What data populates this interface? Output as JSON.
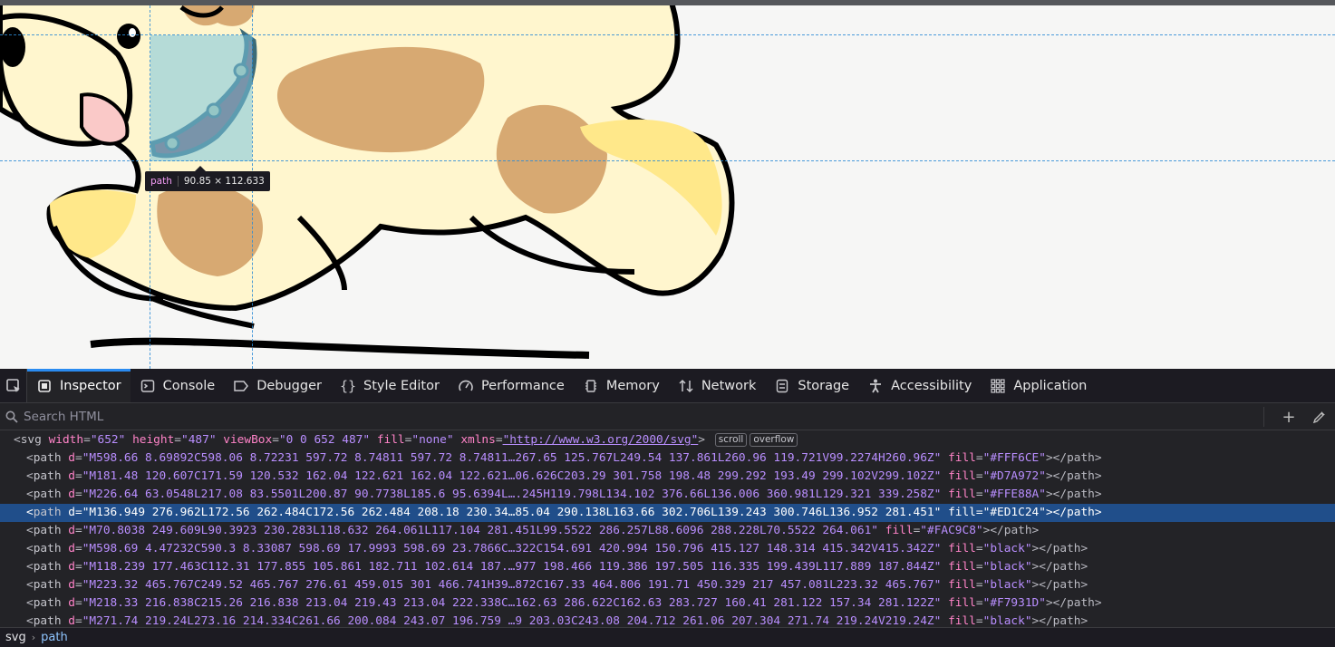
{
  "highlighter": {
    "tooltip_tag": "path",
    "tooltip_dims": "90.85 × 112.633"
  },
  "tabs": [
    {
      "label": "Inspector",
      "icon": "inspector-icon"
    },
    {
      "label": "Console",
      "icon": "console-icon"
    },
    {
      "label": "Debugger",
      "icon": "debugger-icon"
    },
    {
      "label": "Style Editor",
      "icon": "braces-icon"
    },
    {
      "label": "Performance",
      "icon": "gauge-icon"
    },
    {
      "label": "Memory",
      "icon": "memory-icon"
    },
    {
      "label": "Network",
      "icon": "arrows-icon"
    },
    {
      "label": "Storage",
      "icon": "storage-icon"
    },
    {
      "label": "Accessibility",
      "icon": "accessibility-icon"
    },
    {
      "label": "Application",
      "icon": "grid-icon"
    }
  ],
  "search": {
    "placeholder": "Search HTML"
  },
  "tree": {
    "root": {
      "tag": "svg",
      "attrs": [
        {
          "name": "width",
          "value": "\"652\""
        },
        {
          "name": "height",
          "value": "\"487\""
        },
        {
          "name": "viewBox",
          "value": "\"0 0 652 487\""
        },
        {
          "name": "fill",
          "value": "\"none\""
        },
        {
          "name": "xmlns",
          "value": "\"http://www.w3.org/2000/svg\""
        }
      ],
      "badges": [
        "scroll",
        "overflow"
      ]
    },
    "rows": [
      {
        "d": "\"M598.66 8.69892C598.06 8.72231 597.72 8.74811 597.72 8.74811…267.65 125.767L249.54 137.861L260.96 119.721V99.2274H260.96Z\"",
        "fill": "\"#FFF6CE\""
      },
      {
        "d": "\"M181.48 120.607C171.59 120.532 162.04 122.621 162.04 122.621…06.626C203.29 301.758 198.48 299.292 193.49 299.102V299.102Z\"",
        "fill": "\"#D7A972\""
      },
      {
        "d": "\"M226.64 63.0548L217.08 83.5501L200.87 90.7738L185.6 95.6394L….245H119.798L134.102 376.66L136.006 360.981L129.321 339.258Z\"",
        "fill": "\"#FFE88A\""
      },
      {
        "d": "\"M136.949 276.962L172.56 262.484C172.56 262.484 208.18 230.34…85.04 290.138L163.66 302.706L139.243 300.746L136.952 281.451\"",
        "fill": "\"#ED1C24\""
      },
      {
        "d": "\"M70.8038 249.609L90.3923 230.283L118.632 264.061L117.104 281.451L99.5522 286.257L88.6096 288.228L70.5522 264.061\"",
        "fill": "\"#FAC9C8\""
      },
      {
        "d": "\"M598.69 4.47232C590.3 8.33087 598.69 17.9993 598.69 23.7866C…322C154.691 420.994 150.796 415.127 148.314 415.342V415.342Z\"",
        "fill": "\"black\""
      },
      {
        "d": "\"M118.239 177.463C112.31 177.855 105.861 182.711 102.614 187.…977 198.466 119.386 197.505 116.335 199.439L117.889 187.844Z\"",
        "fill": "\"black\""
      },
      {
        "d": "\"M223.32 465.767C249.52 465.767 276.61 459.015 301 466.741H39…872C167.33 464.806 191.71 450.329 217 457.081L223.32 465.767\"",
        "fill": "\"black\""
      },
      {
        "d": "\"M218.33 216.838C215.26 216.838 213.04 219.43 213.04 222.338C…162.63 286.622C162.63 283.727 160.41 281.122 157.34 281.122Z\"",
        "fill": "\"#F7931D\""
      },
      {
        "d": "\"M271.74 219.24L273.16 214.334C261.66 200.084 243.07 196.759 …9 203.03C243.08 204.712 261.06 207.304 271.74 219.24V219.24Z\"",
        "fill": "\"black\""
      }
    ],
    "selected_index": 3,
    "path_tag": "path"
  },
  "breadcrumbs": [
    "svg",
    "path"
  ],
  "colors": {
    "accent": "#2a8bf0",
    "selected_row": "#204e8a",
    "attr_name": "#ff83c8",
    "attr_value": "#b98eff"
  }
}
